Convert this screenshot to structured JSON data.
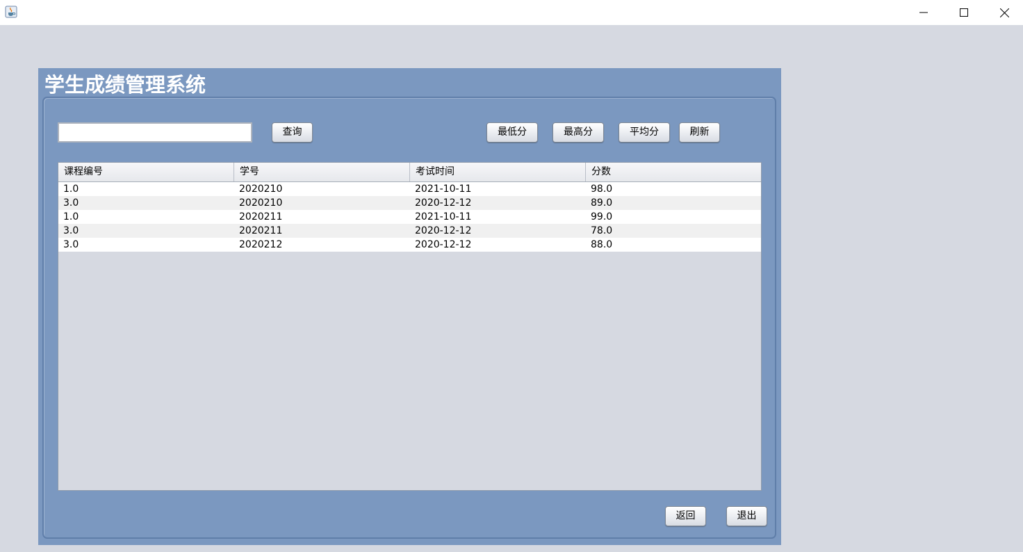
{
  "window": {
    "app_icon": "java-cup-icon",
    "controls": [
      "minimize-icon",
      "maximize-icon",
      "close-icon"
    ]
  },
  "panel": {
    "title": "学生成绩管理系统"
  },
  "search": {
    "value": "",
    "query_button": "查询"
  },
  "toolbar": {
    "min_label": "最低分",
    "max_label": "最高分",
    "avg_label": "平均分",
    "refresh_label": "刷新"
  },
  "table": {
    "columns": [
      "课程编号",
      "学号",
      "考试时间",
      "分数"
    ],
    "rows": [
      [
        "1.0",
        "2020210",
        "2021-10-11",
        "98.0"
      ],
      [
        "3.0",
        "2020210",
        "2020-12-12",
        "89.0"
      ],
      [
        "1.0",
        "2020211",
        "2021-10-11",
        "99.0"
      ],
      [
        "3.0",
        "2020211",
        "2020-12-12",
        "78.0"
      ],
      [
        "3.0",
        "2020212",
        "2020-12-12",
        "88.0"
      ]
    ]
  },
  "footer": {
    "back_label": "返回",
    "exit_label": "退出"
  }
}
